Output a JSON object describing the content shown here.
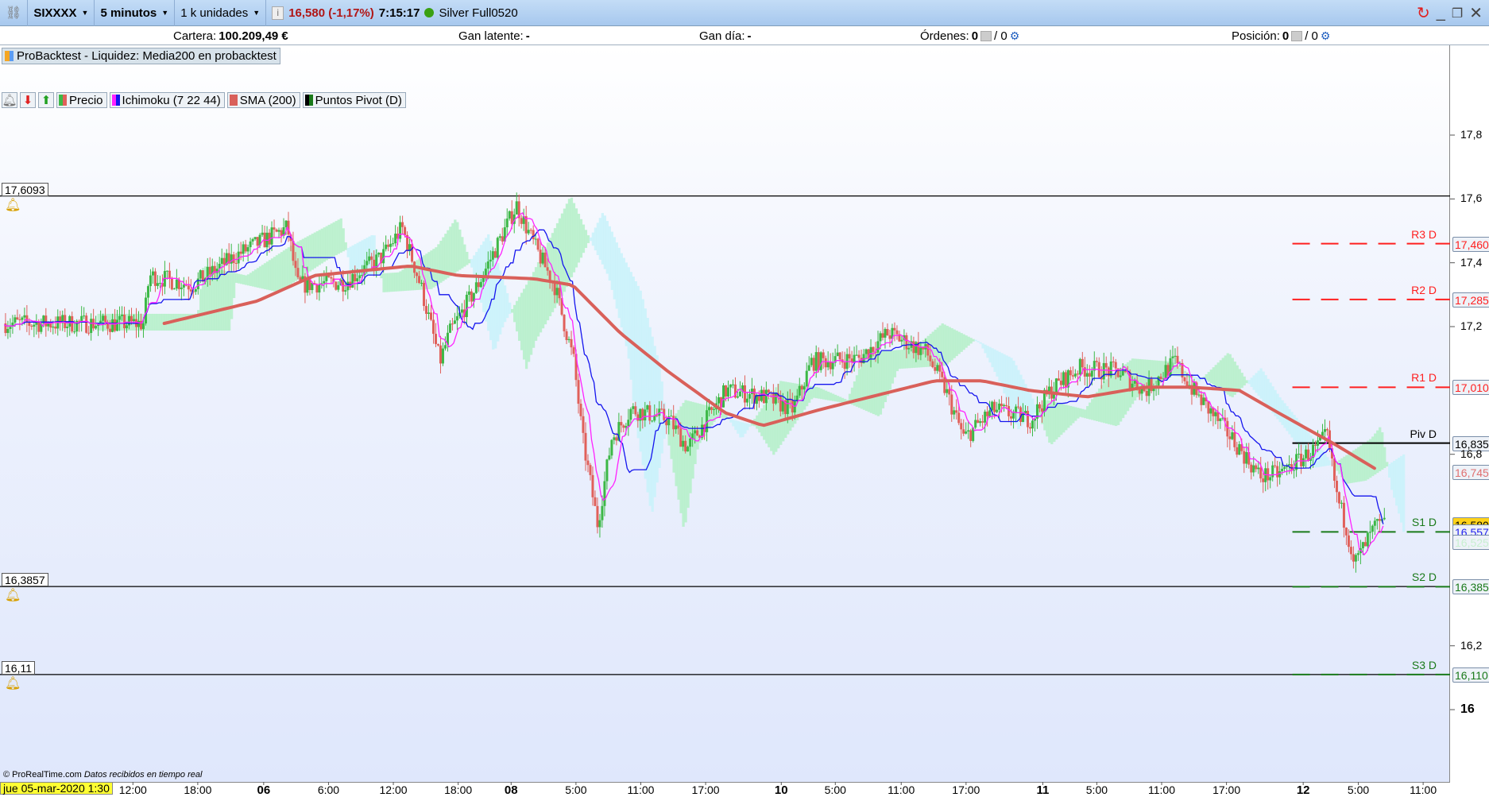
{
  "toolbar": {
    "symbol": "SIXXXX",
    "timeframe": "5 minutos",
    "units": "1 k unidades",
    "price_change": "16,580 (-1,17%)",
    "time": "7:15:17",
    "contract": "Silver Full0520"
  },
  "infobar": {
    "portfolio_label": "Cartera:",
    "portfolio_value": "100.209,49 €",
    "unrealized_label": "Gan latente:",
    "unrealized_value": "-",
    "daily_label": "Gan día:",
    "daily_value": "-",
    "orders_label": "Órdenes:",
    "orders_value": "0",
    "orders_sep": "/ 0",
    "position_label": "Posición:",
    "position_value": "0",
    "position_sep": "/ 0"
  },
  "backtest_label": "ProBacktest - Liquidez: Media200 en probacktest",
  "legend": {
    "price": "Precio",
    "ichimoku": "Ichimoku (7 22 44)",
    "sma": "SMA (200)",
    "pivots": "Puntos Pivot (D)"
  },
  "alerts": [
    {
      "label": "17,6093",
      "value": 17.6093
    },
    {
      "label": "16,3857",
      "value": 16.3857
    },
    {
      "label": "16,11",
      "value": 16.11
    }
  ],
  "footer": {
    "copyright": "© ProRealTime.com",
    "status": "Datos recibidos en tiempo real"
  },
  "date_cursor": "jue 05-mar-2020 1:30",
  "colors": {
    "up": "#3cb846",
    "down": "#e0605a",
    "sma": "#d9605a",
    "tenkan": "#ff22ff",
    "kijun": "#1515ee",
    "cloud_up": "#b4f0c8",
    "cloud_dn": "#c8f2fa",
    "resist": "#ff2020",
    "support": "#1a7a1a"
  },
  "chart_data": {
    "type": "candlestick",
    "x_unit": "hours since 05-mar 1:30",
    "xlim": [
      0,
      134
    ],
    "ylim": [
      15.85,
      18.0
    ],
    "y_ticks": [
      {
        "v": 17.8,
        "l": "17,8"
      },
      {
        "v": 17.6,
        "l": "17,6"
      },
      {
        "v": 17.4,
        "l": "17,4"
      },
      {
        "v": 17.2,
        "l": "17,2"
      },
      {
        "v": 16.8,
        "l": "16,8"
      },
      {
        "v": 16.2,
        "l": "16,2"
      },
      {
        "v": 16.0,
        "l": "16"
      }
    ],
    "x_ticks": [
      {
        "h": 12.3,
        "l": "12:00"
      },
      {
        "h": 18.3,
        "l": "18:00"
      },
      {
        "h": 24.4,
        "l": "06",
        "b": 1
      },
      {
        "h": 30.4,
        "l": "6:00"
      },
      {
        "h": 36.4,
        "l": "12:00"
      },
      {
        "h": 42.4,
        "l": "18:00"
      },
      {
        "h": 47.3,
        "l": "08",
        "b": 1
      },
      {
        "h": 53.3,
        "l": "5:00"
      },
      {
        "h": 59.3,
        "l": "11:00"
      },
      {
        "h": 65.3,
        "l": "17:00"
      },
      {
        "h": 72.3,
        "l": "10",
        "b": 1
      },
      {
        "h": 77.3,
        "l": "5:00"
      },
      {
        "h": 83.4,
        "l": "11:00"
      },
      {
        "h": 89.4,
        "l": "17:00"
      },
      {
        "h": 96.5,
        "l": "11",
        "b": 1
      },
      {
        "h": 101.5,
        "l": "5:00"
      },
      {
        "h": 107.5,
        "l": "11:00"
      },
      {
        "h": 113.5,
        "l": "17:00"
      },
      {
        "h": 120.6,
        "l": "12",
        "b": 1
      },
      {
        "h": 125.7,
        "l": "5:00"
      },
      {
        "h": 131.7,
        "l": "11:00"
      }
    ],
    "price_path": [
      [
        0.4,
        17.21
      ],
      [
        13.2,
        17.21
      ],
      [
        13.7,
        17.36
      ],
      [
        17.7,
        17.33
      ],
      [
        22.1,
        17.43
      ],
      [
        26.5,
        17.51
      ],
      [
        27.4,
        17.33
      ],
      [
        31.8,
        17.34
      ],
      [
        35.3,
        17.42
      ],
      [
        37.1,
        17.51
      ],
      [
        38.8,
        17.33
      ],
      [
        40.6,
        17.09
      ],
      [
        41.5,
        17.18
      ],
      [
        44.1,
        17.33
      ],
      [
        47.7,
        17.58
      ],
      [
        49.4,
        17.45
      ],
      [
        51.2,
        17.33
      ],
      [
        53.0,
        17.09
      ],
      [
        53.8,
        16.85
      ],
      [
        55.2,
        16.58
      ],
      [
        56.5,
        16.85
      ],
      [
        58.3,
        16.94
      ],
      [
        61.8,
        16.91
      ],
      [
        63.5,
        16.82
      ],
      [
        67.1,
        17.0
      ],
      [
        70.6,
        16.98
      ],
      [
        73.3,
        16.94
      ],
      [
        75.0,
        17.09
      ],
      [
        79.4,
        17.1
      ],
      [
        82.1,
        17.18
      ],
      [
        85.6,
        17.12
      ],
      [
        87.4,
        17.0
      ],
      [
        89.1,
        16.85
      ],
      [
        91.8,
        16.94
      ],
      [
        95.3,
        16.91
      ],
      [
        97.1,
        17.0
      ],
      [
        99.7,
        17.07
      ],
      [
        103.3,
        17.06
      ],
      [
        105.9,
        17.0
      ],
      [
        108.6,
        17.09
      ],
      [
        110.3,
        17.0
      ],
      [
        113.9,
        16.85
      ],
      [
        116.5,
        16.73
      ],
      [
        118.3,
        16.74
      ],
      [
        121.8,
        16.82
      ],
      [
        122.7,
        16.86
      ],
      [
        123.6,
        16.67
      ],
      [
        124.4,
        16.58
      ],
      [
        125.3,
        16.46
      ],
      [
        127.1,
        16.57
      ],
      [
        128.0,
        16.58
      ]
    ],
    "sma_path": [
      [
        15.2,
        17.21
      ],
      [
        23.8,
        17.28
      ],
      [
        29.1,
        17.36
      ],
      [
        38.0,
        17.39
      ],
      [
        42.4,
        17.36
      ],
      [
        49.4,
        17.35
      ],
      [
        53,
        17.33
      ],
      [
        57.4,
        17.18
      ],
      [
        61.8,
        17.06
      ],
      [
        67.1,
        16.93
      ],
      [
        70.6,
        16.89
      ],
      [
        75.9,
        16.94
      ],
      [
        79.4,
        16.97
      ],
      [
        86.5,
        17.03
      ],
      [
        90.9,
        17.03
      ],
      [
        95.3,
        17.0
      ],
      [
        100.6,
        16.98
      ],
      [
        105.9,
        17.01
      ],
      [
        110.3,
        17.01
      ],
      [
        114.7,
        17.0
      ],
      [
        118.3,
        16.93
      ],
      [
        123.6,
        16.83
      ],
      [
        127.5,
        16.75
      ]
    ],
    "pivots": {
      "start_h": 119.6,
      "levels": [
        {
          "name": "R3 D",
          "v": 17.46,
          "l": "17,460",
          "kind": "r"
        },
        {
          "name": "R2 D",
          "v": 17.285,
          "l": "17,285",
          "kind": "r"
        },
        {
          "name": "R1 D",
          "v": 17.01,
          "l": "17,010",
          "kind": "r"
        },
        {
          "name": "Piv D",
          "v": 16.835,
          "l": "16,835",
          "kind": "p"
        },
        {
          "name": "S1 D",
          "v": 16.557,
          "l": "",
          "kind": "s"
        },
        {
          "name": "S2 D",
          "v": 16.385,
          "l": "16,385",
          "kind": "s"
        },
        {
          "name": "S3 D",
          "v": 16.11,
          "l": "16,110",
          "kind": "s"
        }
      ]
    },
    "last_labels": [
      {
        "v": 16.745,
        "l": "16,745",
        "c": "#e07070",
        "bg": "#eef2f8"
      },
      {
        "v": 16.58,
        "l": "16,580",
        "c": "#000",
        "bg": "#ffd21a"
      },
      {
        "v": 16.557,
        "l": "16,557",
        "c": "#2222ee",
        "bg": "#eef2f8"
      },
      {
        "v": 16.525,
        "l": "16,525",
        "c": "#c8f0d0",
        "bg": "#eef2f8"
      }
    ]
  }
}
